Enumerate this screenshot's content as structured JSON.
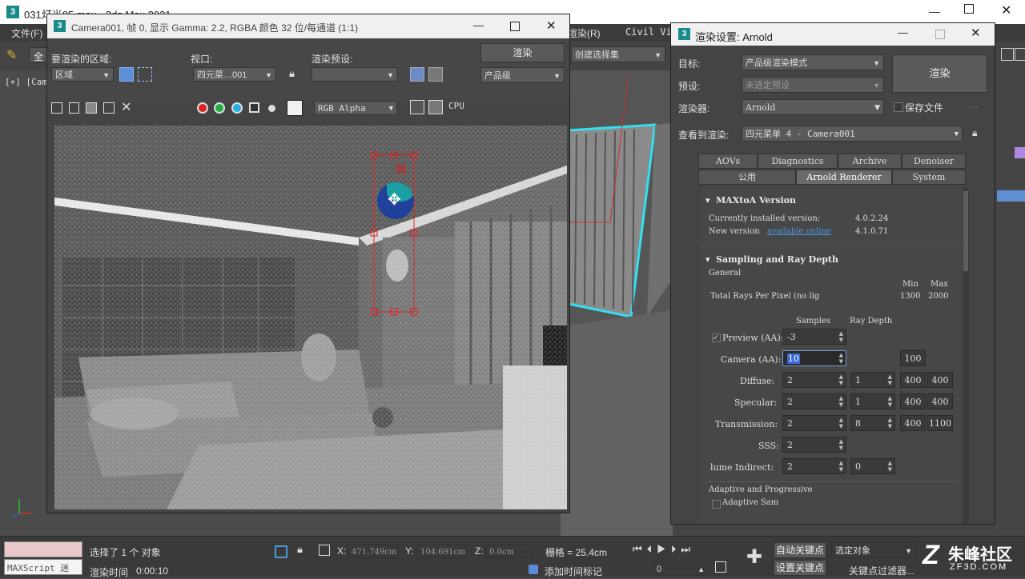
{
  "main_window": {
    "title": "031灯光05.max - 3ds Max 2021",
    "menu": [
      "文件(F)",
      "渲染(R)",
      "Civil Vi"
    ],
    "toolbar_partial": "全",
    "viewport_label": "[+] [Came",
    "selection_set": "创建选择集"
  },
  "camera_window": {
    "title": "Camera001, 帧 0, 显示 Gamma: 2.2, RGBA 颜色 32 位/每通道 (1:1)",
    "area_label": "要渲染的区域:",
    "area_value": "区域",
    "viewport_label": "视口:",
    "viewport_value": "四元菜…001",
    "preset_label": "渲染预设:",
    "preset_value": "",
    "render_button": "渲染",
    "quality_value": "产品级",
    "channel_value": "RGB Alpha",
    "cpu_label": "CPU"
  },
  "render_settings": {
    "title": "渲染设置: Arnold",
    "target_label": "目标:",
    "target_value": "产品级渲染模式",
    "preset_label": "预设:",
    "preset_value": "未选定预设",
    "renderer_label": "渲染器:",
    "renderer_value": "Arnold",
    "save_file_label": "保存文件",
    "render_button": "渲染",
    "view_label": "查看到渲染:",
    "view_value": "四元菜单 4 - Camera001",
    "tabs_row1": [
      "AOVs",
      "Diagnostics",
      "Archive",
      "Denoiser"
    ],
    "tabs_row2": [
      "公用",
      "Arnold Renderer",
      "System"
    ],
    "maxtoa": {
      "header": "MAXtoA Version",
      "installed_label": "Currently installed version:",
      "installed_value": "4.0.2.24",
      "new_label": "New version",
      "new_link": "available online",
      "new_value": "4.1.0.71"
    },
    "sampling": {
      "header": "Sampling and Ray Depth",
      "general_label": "General",
      "min_label": "Min",
      "max_label": "Max",
      "total_rays_label": "Total Rays Per Pixel (no lig",
      "total_min": "1300",
      "total_max": "2000",
      "samples_label": "Samples",
      "raydepth_label": "Ray Depth",
      "rows": [
        {
          "label": "Preview (AA):",
          "samples": "-3",
          "depth": "",
          "min": "",
          "max": ""
        },
        {
          "label": "Camera (AA):",
          "samples": "10",
          "depth": "",
          "min": "100",
          "max": ""
        },
        {
          "label": "Diffuse:",
          "samples": "2",
          "depth": "1",
          "min": "400",
          "max": "400"
        },
        {
          "label": "Specular:",
          "samples": "2",
          "depth": "1",
          "min": "400",
          "max": "400"
        },
        {
          "label": "Transmission:",
          "samples": "2",
          "depth": "8",
          "min": "400",
          "max": "1100"
        },
        {
          "label": "SSS:",
          "samples": "2",
          "depth": "",
          "min": "",
          "max": ""
        },
        {
          "label": "lume Indirect:",
          "samples": "2",
          "depth": "0",
          "min": "",
          "max": ""
        }
      ],
      "adaptive_label": "Adaptive and Progressive",
      "adaptive_sampling": "Adaptive Sam"
    }
  },
  "status": {
    "maxscript": "MAXScript 迷",
    "selected": "选择了 1 个 对象",
    "render_time_label": "渲染时间",
    "render_time": "0:00:10",
    "x_label": "X:",
    "x_value": "471.749cm",
    "y_label": "Y:",
    "y_value": "104.691cm",
    "z_label": "Z:",
    "z_value": "0.0cm",
    "grid": "栅格 = 25.4cm",
    "add_time_tag": "添加时间标记",
    "auto_key": "自动关键点",
    "set_key": "设置关键点",
    "selected_object": "选定对象",
    "key_filter": "关键点过滤器...",
    "frame": "0",
    "watermark": "朱峰社区",
    "watermark_url": "ZF3D.COM"
  }
}
